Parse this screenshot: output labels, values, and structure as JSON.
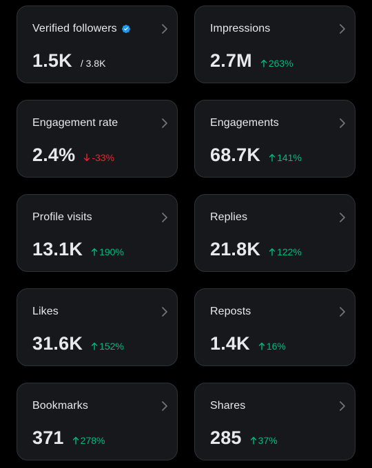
{
  "cards": [
    {
      "title": "Verified followers",
      "value": "1.5K",
      "sub": "/ 3.8K"
    },
    {
      "title": "Impressions",
      "value": "2.7M",
      "change": "263%",
      "direction": "up"
    },
    {
      "title": "Engagement rate",
      "value": "2.4%",
      "change": "-33%",
      "direction": "down"
    },
    {
      "title": "Engagements",
      "value": "68.7K",
      "change": "141%",
      "direction": "up"
    },
    {
      "title": "Profile visits",
      "value": "13.1K",
      "change": "190%",
      "direction": "up"
    },
    {
      "title": "Replies",
      "value": "21.8K",
      "change": "122%",
      "direction": "up"
    },
    {
      "title": "Likes",
      "value": "31.6K",
      "change": "152%",
      "direction": "up"
    },
    {
      "title": "Reposts",
      "value": "1.4K",
      "change": "16%",
      "direction": "up"
    },
    {
      "title": "Bookmarks",
      "value": "371",
      "change": "278%",
      "direction": "up"
    },
    {
      "title": "Shares",
      "value": "285",
      "change": "37%",
      "direction": "up"
    }
  ],
  "icons": {
    "chevron": "chevron-right-icon",
    "verified": "verified-badge-icon",
    "up": "arrow-up-icon",
    "down": "arrow-down-icon"
  },
  "colors": {
    "positive": "#00ba7c",
    "negative": "#f4212e",
    "verified": "#1d9bf0"
  }
}
